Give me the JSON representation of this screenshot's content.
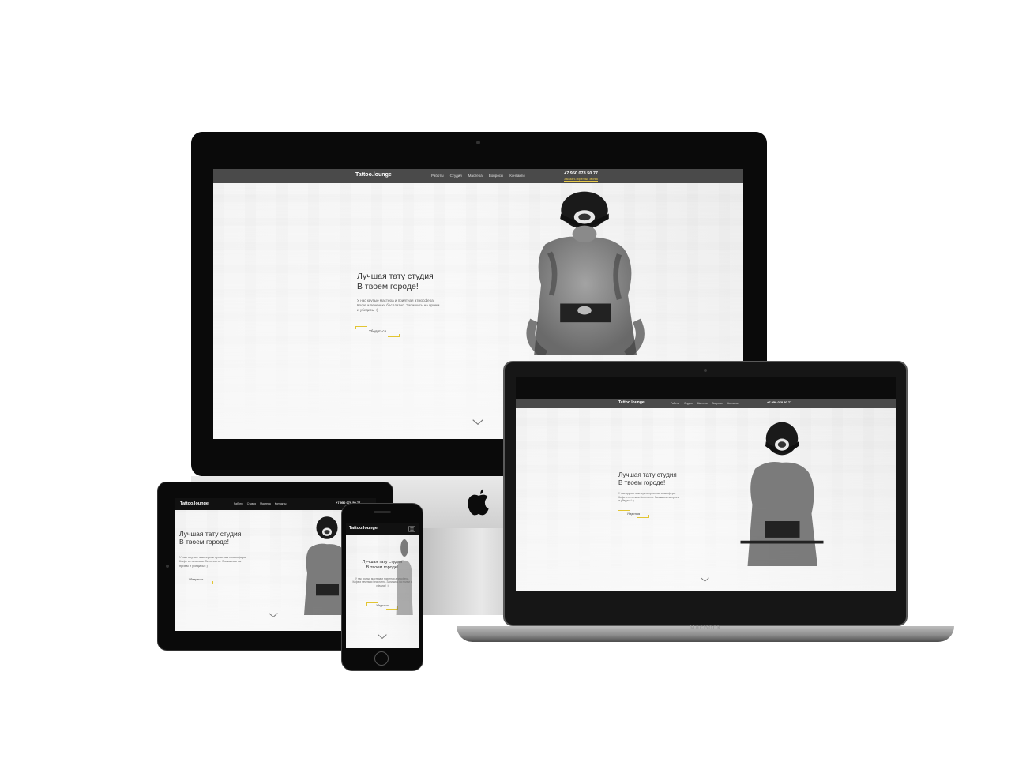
{
  "site": {
    "logo": "Tattoo.lounge",
    "menu_desktop": [
      "Работы",
      "Студия",
      "Мастера",
      "Вопросы",
      "Контакты"
    ],
    "phone": "+7 950 078 50 77",
    "callback": "Заказать обратный звонок",
    "hero_line1": "Лучшая тату студия",
    "hero_line2": "В твоем городе!",
    "hero_text": "У нас крутые мастера и приятная атмосфера. Кофе и печеньки бесплатно. Запишись на прием и убедись! :)",
    "cta_label": "Убедиться"
  },
  "devices": {
    "macbook_label": "MacBook"
  },
  "colors": {
    "nav_bg": "#4a4a4a",
    "accent_yellow": "#e2c532",
    "device_black": "#0a0a0a"
  },
  "icons": {
    "apple_logo": "apple-logo-icon",
    "scroll_down": "chevron-down-icon",
    "mobile_menu": "hamburger-menu-icon"
  }
}
